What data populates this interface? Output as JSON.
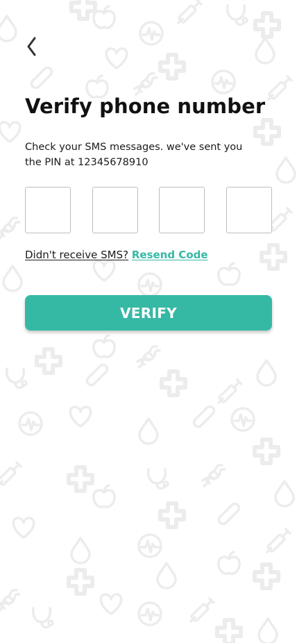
{
  "header": {
    "back_icon": "chevron-left-icon"
  },
  "title": "Verify phone number",
  "subtitle": "Check your SMS messages. we've sent you the PIN at 12345678910",
  "pin": {
    "digits": [
      "",
      "",
      "",
      ""
    ]
  },
  "resend": {
    "question": "Didn't receive SMS?",
    "link_label": "Resend Code"
  },
  "verify_button_label": "VERIFY",
  "colors": {
    "accent": "#35b9a5",
    "pattern": "#ededed",
    "text": "#111111",
    "input_border": "#bdbdbd"
  },
  "background": {
    "pattern_icons": [
      "apple-icon",
      "plus-icon",
      "heart-icon",
      "drop-icon",
      "syringe-icon",
      "dna-icon",
      "stethoscope-icon",
      "pulse-logo-icon",
      "pill-icon"
    ]
  }
}
